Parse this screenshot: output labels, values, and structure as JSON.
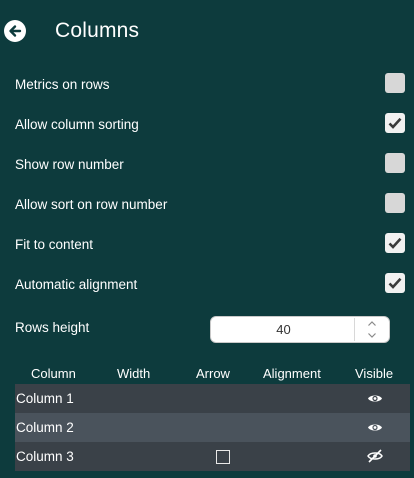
{
  "header": {
    "title": "Columns",
    "back_icon": "back-arrow-circle-icon"
  },
  "options": [
    {
      "label": "Metrics on rows",
      "checked": false
    },
    {
      "label": "Allow column sorting",
      "checked": true
    },
    {
      "label": "Show row number",
      "checked": false
    },
    {
      "label": "Allow sort on row number",
      "checked": false
    },
    {
      "label": "Fit to content",
      "checked": true
    },
    {
      "label": "Automatic alignment",
      "checked": true
    }
  ],
  "rows_height": {
    "label": "Rows height",
    "value": "40"
  },
  "table": {
    "headers": [
      "Column",
      "Width",
      "Arrow",
      "Alignment",
      "Visible"
    ],
    "rows": [
      {
        "name": "Column 1",
        "arrow_checkbox": false,
        "visible": true
      },
      {
        "name": "Column 2",
        "arrow_checkbox": false,
        "visible": true
      },
      {
        "name": "Column 3",
        "arrow_checkbox": true,
        "visible": false
      }
    ]
  },
  "colors": {
    "background": "#0d3b3d",
    "row_odd": "#3a4148",
    "row_even": "#4a535c",
    "checkbox_bg": "#f1f1f1",
    "check_mark": "#3a3a3a"
  }
}
